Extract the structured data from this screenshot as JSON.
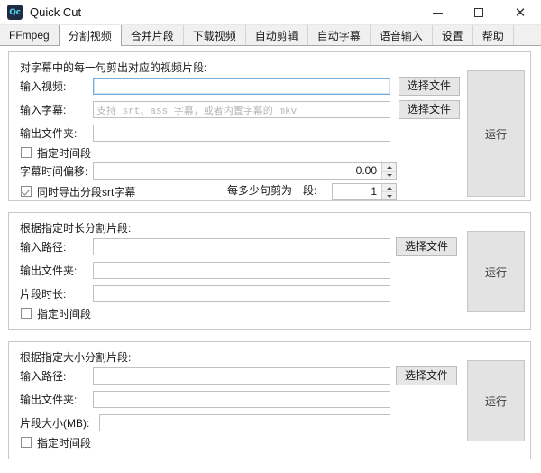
{
  "window": {
    "icon_text": "Qc",
    "title": "Quick Cut",
    "controls": {
      "minimize": "minimize-icon",
      "maximize": "maximize-icon",
      "close": "close-icon",
      "close_glyph": "✕"
    }
  },
  "tabs": [
    {
      "label": "FFmpeg",
      "active": false
    },
    {
      "label": "分割视频",
      "active": true
    },
    {
      "label": "合并片段",
      "active": false
    },
    {
      "label": "下载视频",
      "active": false
    },
    {
      "label": "自动剪辑",
      "active": false
    },
    {
      "label": "自动字幕",
      "active": false
    },
    {
      "label": "语音输入",
      "active": false
    },
    {
      "label": "设置",
      "active": false
    },
    {
      "label": "帮助",
      "active": false
    }
  ],
  "panels": {
    "subtitle_split": {
      "title": "对字幕中的每一句剪出对应的视频片段:",
      "video_label": "输入视频:",
      "video_value": "",
      "video_placeholder": "",
      "video_browse": "选择文件",
      "subtitle_label": "输入字幕:",
      "subtitle_value": "",
      "subtitle_placeholder": "支持 srt、ass 字幕，或者内置字幕的 mkv",
      "subtitle_browse": "选择文件",
      "output_label": "输出文件夹:",
      "output_value": "",
      "time_range_check": "指定时间段",
      "time_range_checked": false,
      "offset_label": "字幕时间偏移:",
      "offset_value": "0.00",
      "export_srt_check": "同时导出分段srt字幕",
      "export_srt_checked": true,
      "sentences_label": "每多少句剪为一段:",
      "sentences_value": "1",
      "run": "运行"
    },
    "duration_split": {
      "title": "根据指定时长分割片段:",
      "input_label": "输入路径:",
      "input_value": "",
      "input_browse": "选择文件",
      "output_label": "输出文件夹:",
      "output_value": "",
      "segment_label": "片段时长:",
      "segment_value": "",
      "time_range_check": "指定时间段",
      "time_range_checked": false,
      "run": "运行"
    },
    "size_split": {
      "title": "根据指定大小分割片段:",
      "input_label": "输入路径:",
      "input_value": "",
      "input_browse": "选择文件",
      "output_label": "输出文件夹:",
      "output_value": "",
      "segment_label": "片段大小(MB):",
      "segment_value": "",
      "time_range_check": "指定时间段",
      "time_range_checked": false,
      "run": "运行"
    }
  }
}
